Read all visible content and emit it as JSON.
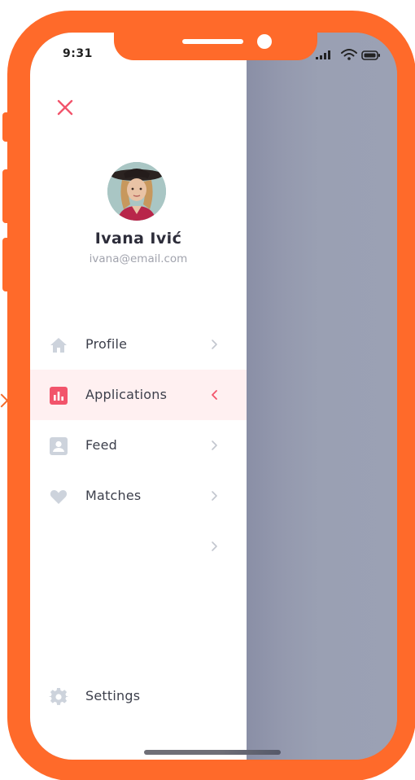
{
  "status_bar": {
    "time": "9:31",
    "icons": [
      "signal-icon",
      "wifi-icon",
      "battery-icon"
    ]
  },
  "drawer": {
    "close_icon": "close-icon",
    "user": {
      "name": "Ivana Ivić",
      "email": "ivana@email.com"
    },
    "menu": [
      {
        "label": "Profile",
        "icon": "home-icon",
        "active": false
      },
      {
        "label": "Applications",
        "icon": "bar-chart-icon",
        "active": true
      },
      {
        "label": "Feed",
        "icon": "contact-card-icon",
        "active": false
      },
      {
        "label": "Matches",
        "icon": "heart-icon",
        "active": false
      },
      {
        "label": "",
        "icon": "",
        "active": false
      }
    ],
    "settings": {
      "label": "Settings",
      "icon": "gear-icon"
    }
  },
  "colors": {
    "frame": "#ff6a2a",
    "accent": "#f2546b",
    "active_bg": "#fff0f1",
    "icon_inactive": "#cdd3dc",
    "overlay": "#9aa0b3"
  }
}
